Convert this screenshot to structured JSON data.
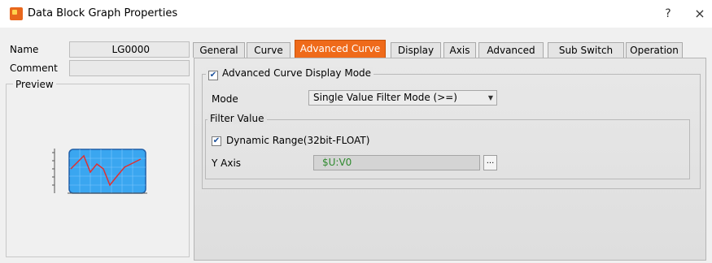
{
  "window": {
    "title": "Data Block Graph Properties",
    "help_glyph": "?",
    "close_glyph": "×"
  },
  "left": {
    "name_label": "Name",
    "name_value": "LG0000",
    "comment_label": "Comment",
    "comment_value": "",
    "preview_label": "Preview"
  },
  "tabs": [
    {
      "label": "General"
    },
    {
      "label": "Curve"
    },
    {
      "label": "Advanced Curve"
    },
    {
      "label": "Display"
    },
    {
      "label": "Axis"
    },
    {
      "label": "Advanced"
    },
    {
      "label": "Sub Switch"
    },
    {
      "label": "Operation"
    }
  ],
  "active_tab": "Advanced Curve",
  "advanced_curve": {
    "display_mode_label": "Advanced Curve Display Mode",
    "display_mode_checked": true,
    "mode_label": "Mode",
    "mode_value": "Single Value Filter Mode (>=)",
    "filter_group_label": "Filter Value",
    "dynamic_range_label": "Dynamic Range(32bit-FLOAT)",
    "dynamic_range_checked": true,
    "yaxis_label": "Y Axis",
    "yaxis_value": "$U:V0",
    "browse_label": "..."
  },
  "colors": {
    "accent": "#ef6a1a",
    "preview_fill": "#3aa6f0",
    "preview_line": "#e03030"
  }
}
